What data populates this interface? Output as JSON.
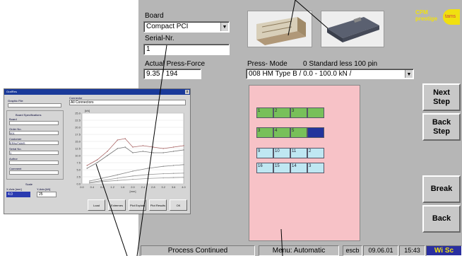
{
  "board": {
    "label": "Board",
    "value": "Compact PCI"
  },
  "serial": {
    "label": "Serial-Nr.",
    "value": "1"
  },
  "force": {
    "label": "Actual Press-Force",
    "value": "9.35 / 194"
  },
  "press_mode": {
    "label": "Press- Mode",
    "info": "0  Standard less 100 pin",
    "value": "008  HM Type B / 0.0 - 100.0 kN /"
  },
  "logo": {
    "line1": "CPM",
    "line2": "prestige",
    "mark": "tams"
  },
  "buttons": {
    "next": "Next Step",
    "back_step": "Back Step",
    "break": "Break",
    "back": "Back"
  },
  "status": {
    "left": "Process Continued",
    "menu": "Menu: Automatic",
    "code": "escb",
    "date": "09.06.01",
    "time": "15:43",
    "user": "Wi Sc"
  },
  "grid": {
    "rows": [
      [
        {
          "t": "1",
          "c": "g"
        },
        {
          "t": "2",
          "c": "g"
        },
        {
          "t": "3",
          "c": "g"
        },
        {
          "t": "",
          "c": "g"
        }
      ],
      [
        {
          "t": "3",
          "c": "g"
        },
        {
          "t": "4",
          "c": "g"
        },
        {
          "t": "5",
          "c": "g"
        },
        {
          "t": "",
          "c": "n"
        }
      ],
      [
        {
          "t": "9",
          "c": "b"
        },
        {
          "t": "10",
          "c": "b"
        },
        {
          "t": "11",
          "c": "b"
        },
        {
          "t": "2",
          "c": "b"
        }
      ],
      [
        {
          "t": "16",
          "c": "b"
        },
        {
          "t": "15",
          "c": "b"
        },
        {
          "t": "14",
          "c": "b"
        },
        {
          "t": "3",
          "c": "b"
        }
      ]
    ]
  },
  "dialog": {
    "title": "GrafRes",
    "connector_label": "Connector",
    "connector_value": "All Connectors",
    "graphic_file": "Graphic File",
    "board_spec": "Board Specifications",
    "fields": [
      {
        "label": "Board",
        "value": ""
      },
      {
        "label": "Order No.",
        "value": "001"
      },
      {
        "label": "Customer",
        "value": "ERNI/TAMS"
      },
      {
        "label": "Serial No.",
        "value": "1"
      },
      {
        "label": "Author",
        "value": ""
      },
      {
        "label": "Comment",
        "value": ""
      }
    ],
    "scale": "Scale",
    "xaxis_label": "X-Axis [mm]",
    "yaxis_label": "Y-Axis [kN]",
    "xaxis_value": "4.0",
    "yaxis_value": "25",
    "buttons": [
      "Load",
      "Extremes",
      "Plot Explain",
      "Plot Results",
      "OK"
    ],
    "chart_data": {
      "type": "line",
      "ylabel": "[kN]",
      "xlabel": "[mm]",
      "xlim": [
        0,
        4.0
      ],
      "ylim": [
        0,
        25
      ],
      "yticks": [
        "25.0",
        "22.5",
        "20.0",
        "17.5",
        "15.0",
        "12.5",
        "10.0",
        "7.5",
        "5.0",
        "2.5",
        "0.0"
      ],
      "xticks": [
        "0.0",
        "0.4",
        "0.8",
        "1.2",
        "1.6",
        "2.0",
        "2.4",
        "2.8",
        "3.2",
        "3.6",
        "4.0"
      ],
      "series": [
        {
          "color": "#aa6666",
          "x": [
            0.2,
            0.6,
            1.0,
            1.4,
            1.7,
            2.0,
            2.4,
            2.8,
            3.2,
            3.6,
            4.0
          ],
          "y": [
            6.5,
            8.5,
            11.5,
            15.5,
            16.0,
            13.0,
            13.5,
            13.0,
            12.5,
            13.0,
            13.5
          ]
        },
        {
          "color": "#777777",
          "x": [
            0.2,
            0.6,
            1.0,
            1.4,
            1.7,
            2.0,
            2.4,
            2.8,
            3.2,
            3.6,
            4.0
          ],
          "y": [
            5.5,
            7.5,
            10.0,
            12.5,
            13.0,
            11.0,
            11.5,
            11.0,
            11.0,
            11.5,
            12.0
          ]
        },
        {
          "color": "#888888",
          "x": [
            0.3,
            0.8,
            1.4,
            2.0,
            2.6,
            3.2,
            3.6,
            4.0
          ],
          "y": [
            1.0,
            2.0,
            3.2,
            4.5,
            5.5,
            6.2,
            6.5,
            6.8
          ]
        },
        {
          "color": "#999999",
          "x": [
            0.3,
            0.8,
            1.4,
            2.0,
            2.6,
            3.2,
            3.6,
            4.0
          ],
          "y": [
            0.5,
            1.2,
            2.0,
            2.8,
            3.3,
            3.6,
            3.7,
            3.8
          ]
        },
        {
          "color": "#999999",
          "x": [
            0.3,
            0.8,
            1.4,
            2.0,
            2.6,
            3.2,
            3.6,
            4.0
          ],
          "y": [
            0.3,
            0.8,
            1.2,
            1.6,
            1.9,
            2.1,
            2.2,
            2.3
          ]
        }
      ]
    }
  }
}
